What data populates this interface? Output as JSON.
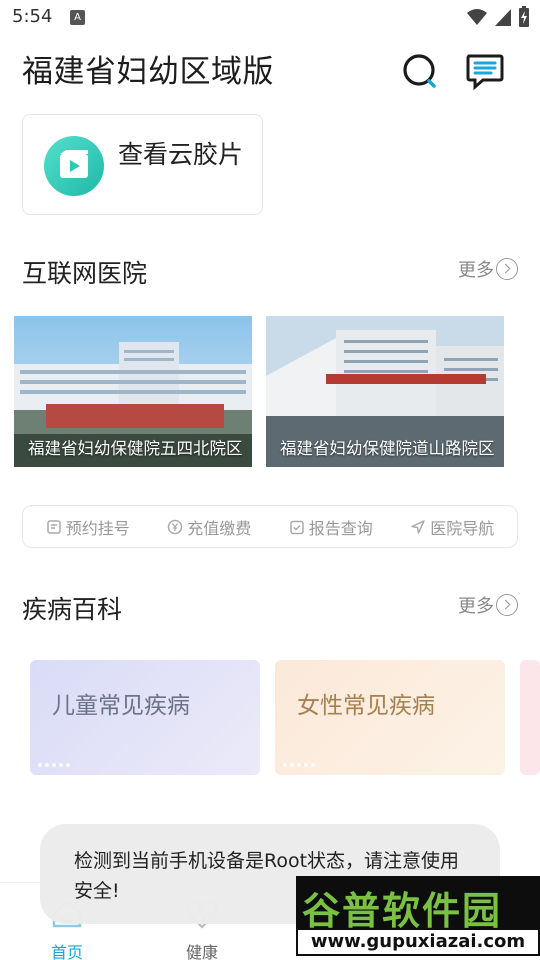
{
  "status_bar": {
    "time": "5:54",
    "notification_letter": "A"
  },
  "header": {
    "title": "福建省妇幼区域版"
  },
  "cloud_film": {
    "label": "查看云胶片"
  },
  "internet_hospital": {
    "title": "互联网医院",
    "more": "更多",
    "hospitals": [
      {
        "caption": "福建省妇幼保健院五四北院区"
      },
      {
        "caption": "福建省妇幼保健院道山路院区"
      }
    ],
    "quick_actions": [
      {
        "label": "预约挂号",
        "icon": "register-icon"
      },
      {
        "label": "充值缴费",
        "icon": "yen-icon"
      },
      {
        "label": "报告查询",
        "icon": "report-check-icon"
      },
      {
        "label": "医院导航",
        "icon": "navigation-icon"
      }
    ]
  },
  "disease_wiki": {
    "title": "疾病百科",
    "more": "更多",
    "cards": [
      {
        "label": "儿童常见疾病",
        "color": "#6b7389"
      },
      {
        "label": "女性常见疾病",
        "color": "#a7804f"
      }
    ]
  },
  "bottom_nav": {
    "items": [
      {
        "label": "首页"
      },
      {
        "label": "健康"
      }
    ]
  },
  "toast": {
    "message": "检测到当前手机设备是Root状态，请注意使用安全!"
  },
  "watermark": {
    "brand": "谷普软件园",
    "url": "www.gupuxiazai.com"
  },
  "colors": {
    "accent": "#1aa6d8",
    "teal": "#2cc9b5",
    "text_gray": "#888888"
  }
}
